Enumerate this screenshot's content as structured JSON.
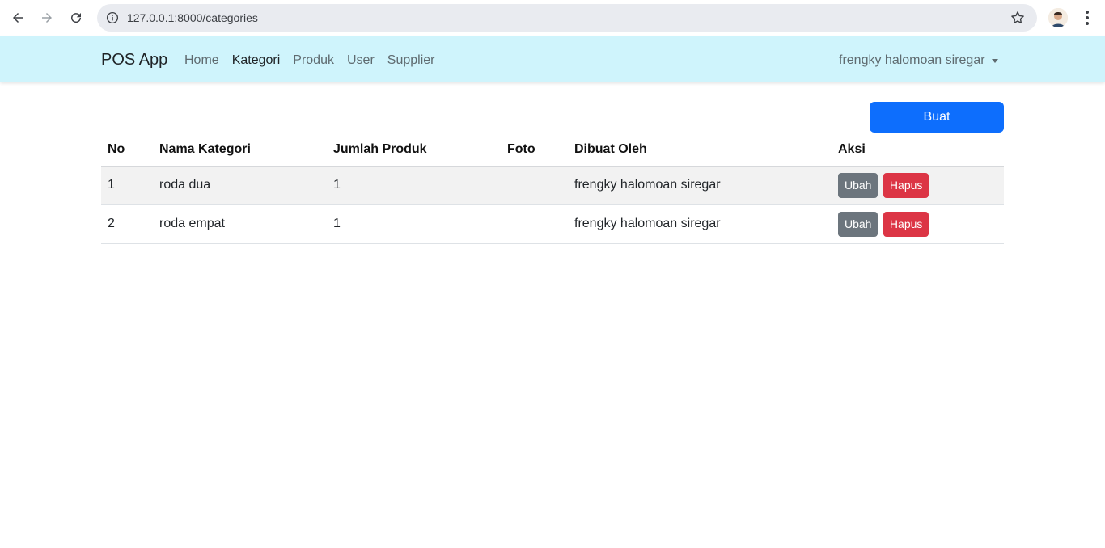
{
  "browser": {
    "url": "127.0.0.1:8000/categories"
  },
  "navbar": {
    "brand": "POS App",
    "links": [
      {
        "label": "Home"
      },
      {
        "label": "Kategori"
      },
      {
        "label": "Produk"
      },
      {
        "label": "User"
      },
      {
        "label": "Supplier"
      }
    ],
    "active": "Kategori",
    "user_name": "frengky halomoan siregar",
    "background_color": "#cff4fc"
  },
  "actions": {
    "create_label": "Buat",
    "create_color": "#0d6efd"
  },
  "table": {
    "headers": [
      "No",
      "Nama Kategori",
      "Jumlah Produk",
      "Foto",
      "Dibuat Oleh",
      "Aksi"
    ],
    "rows": [
      {
        "no": "1",
        "nama": "roda dua",
        "jumlah": "1",
        "foto": "",
        "dibuat": "frengky halomoan siregar",
        "edit": "Ubah",
        "delete": "Hapus"
      },
      {
        "no": "2",
        "nama": "roda empat",
        "jumlah": "1",
        "foto": "",
        "dibuat": "frengky halomoan siregar",
        "edit": "Ubah",
        "delete": "Hapus"
      }
    ]
  }
}
